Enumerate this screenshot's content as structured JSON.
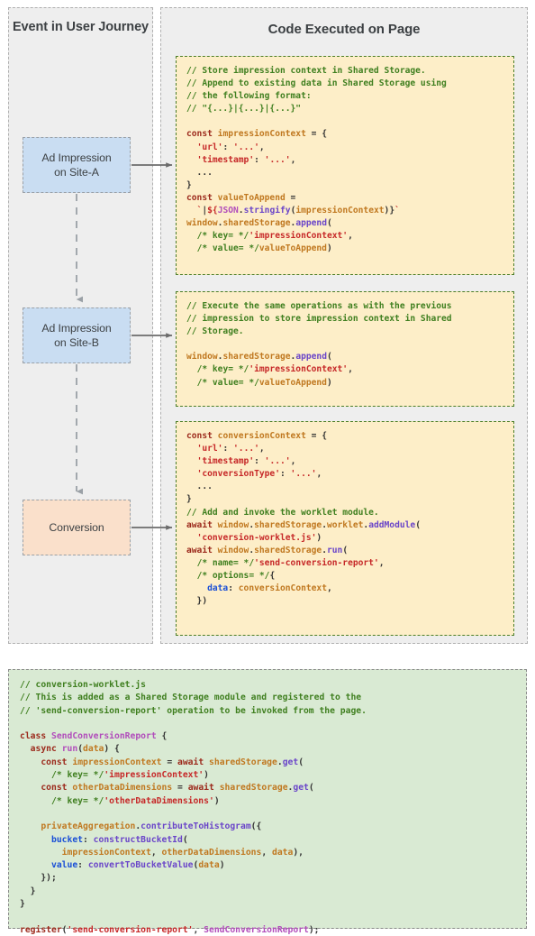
{
  "panels": {
    "left": {
      "title": "Event in User Journey"
    },
    "right": {
      "title": "Code Executed on Page"
    }
  },
  "flow": {
    "nodes": [
      {
        "id": "node-a",
        "label": "Ad Impression on Site-A",
        "line1": "Ad Impression",
        "line2": "on Site-A",
        "fill": "#c9ddf2"
      },
      {
        "id": "node-b",
        "label": "Ad Impression on Site-B",
        "line1": "Ad Impression",
        "line2": "on Site-B",
        "fill": "#c9ddf2"
      },
      {
        "id": "node-conversion",
        "label": "Conversion",
        "line1": "Conversion",
        "line2": "",
        "fill": "#fae0cb"
      }
    ],
    "connectors": [
      {
        "from": "node-a",
        "to": "node-b",
        "style": "dashed-vertical"
      },
      {
        "from": "node-b",
        "to": "node-conversion",
        "style": "dashed-vertical"
      },
      {
        "from": "node-a",
        "to": "code-1",
        "style": "solid-horizontal"
      },
      {
        "from": "node-b",
        "to": "code-2",
        "style": "solid-horizontal"
      },
      {
        "from": "node-conversion",
        "to": "code-3",
        "style": "solid-horizontal"
      }
    ]
  },
  "code_blocks": {
    "impression_a": {
      "name": "code-block-impression-site-a",
      "background": "#fdeec8",
      "text": "// Store impression context in Shared Storage.\n// Append to existing data in Shared Storage using\n// the following format:\n// \"{...}|{...}|{...}\"\n\nconst impressionContext = {\n  'url': '...',\n  'timestamp': '...',\n  ...\n}\nconst valueToAppend =\n  `|${JSON.stringify(impressionContext)}`\nwindow.sharedStorage.append(\n  /* key= */'impressionContext',\n  /* value= */valueToAppend)"
    },
    "impression_b": {
      "name": "code-block-impression-site-b",
      "background": "#fdeec8",
      "text": "// Execute the same operations as with the previous\n// impression to store impression context in Shared\n// Storage.\n\nwindow.sharedStorage.append(\n  /* key= */'impressionContext',\n  /* value= */valueToAppend)"
    },
    "conversion": {
      "name": "code-block-conversion",
      "background": "#fdeec8",
      "text": "const conversionContext = {\n  'url': '...',\n  'timestamp': '...',\n  'conversionType': '...',\n  ...\n}\n// Add and invoke the worklet module.\nawait window.sharedStorage.worklet.addModule(\n  'conversion-worklet.js')\nawait window.sharedStorage.run(\n  /* name= */'send-conversion-report',\n  /* options= */{\n    data: conversionContext,\n  })"
    },
    "worklet": {
      "name": "code-block-conversion-worklet",
      "background": "#d9ead3",
      "text": "// conversion-worklet.js\n// This is added as a Shared Storage module and registered to the\n// 'send-conversion-report' operation to be invoked from the page.\n\nclass SendConversionReport {\n  async run(data) {\n    const impressionContext = await sharedStorage.get(\n      /* key= */'impressionContext')\n    const otherDataDimensions = await sharedStorage.get(\n      /* key= */'otherDataDimensions')\n\n    privateAggregation.contributeToHistogram({\n      bucket: constructBucketId(\n        impressionContext, otherDataDimensions, data),\n      value: convertToBucketValue(data)\n    });\n  }\n}\n\nregister('send-conversion-report', SendConversionReport);"
    }
  },
  "colors": {
    "panel_bg": "#eeeeee",
    "panel_border": "#b0b0b0",
    "impression_node": "#c9ddf2",
    "conversion_node": "#fae0cb",
    "code_yellow": "#fdeec8",
    "code_yellow_border": "#4a7d27",
    "code_green": "#d9ead3",
    "arrow": "#6b6b6b",
    "comment": "#3f7f1f",
    "keyword": "#9c2a1c",
    "string": "#c62828",
    "identifier": "#c07820",
    "property": "#1a4fd6",
    "function": "#6a45c9"
  }
}
